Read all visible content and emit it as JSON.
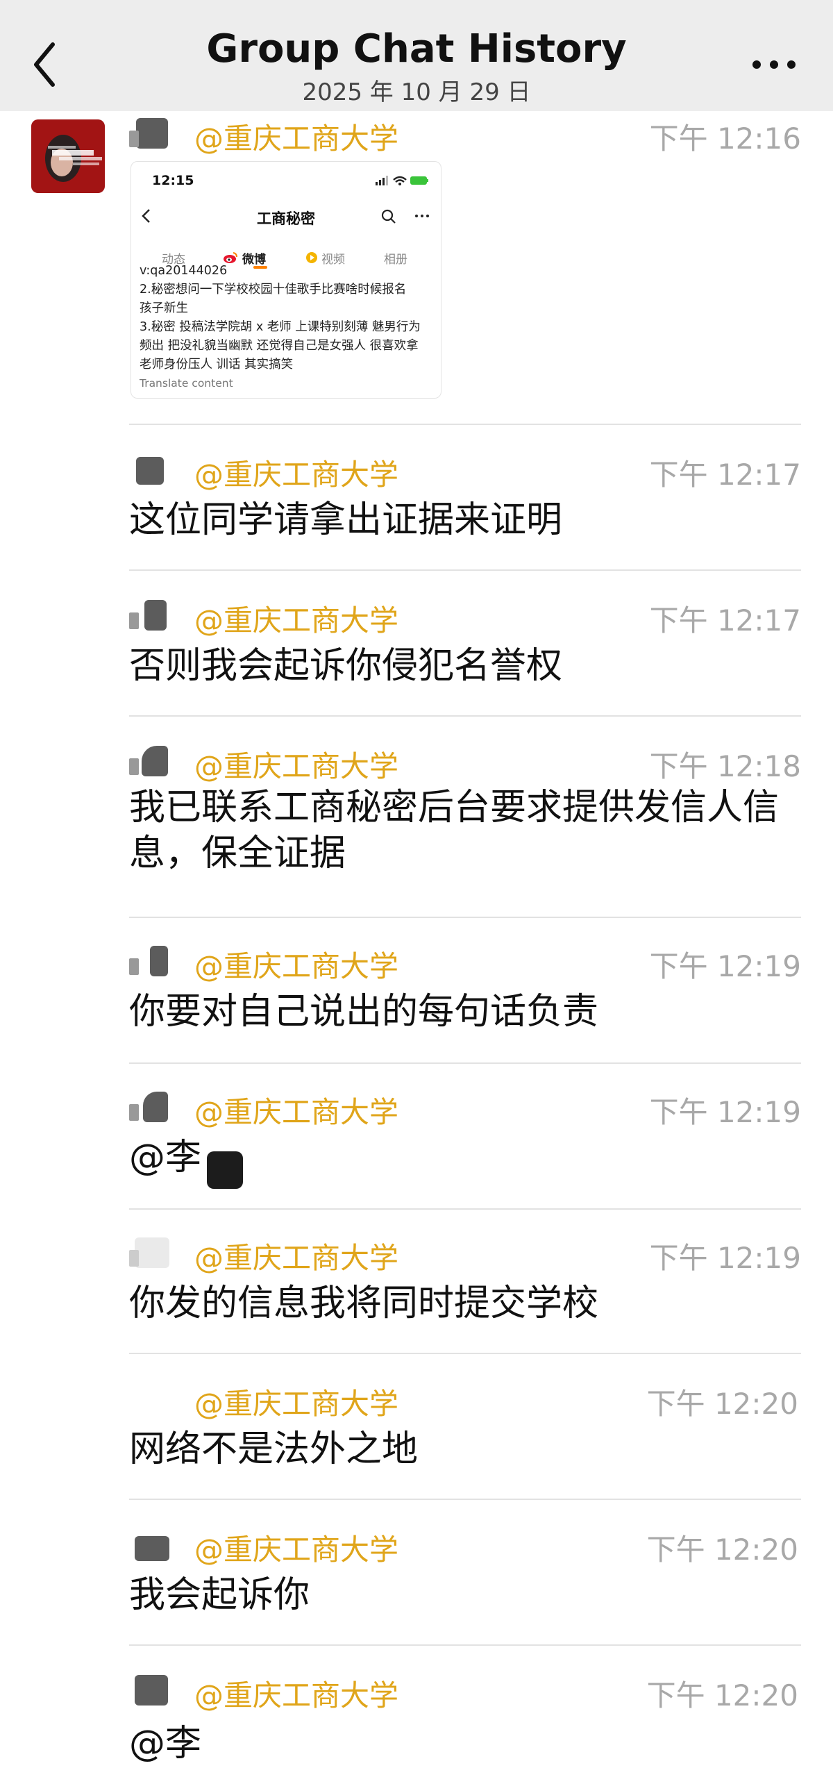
{
  "header": {
    "title": "Group Chat History",
    "date": "2025 年 10 月 29 日"
  },
  "accent_color": "#e0a51a",
  "embedded_screenshot": {
    "status_time": "12:15",
    "page_title": "工商秘密",
    "tabs": [
      "动态",
      "微博",
      "视频",
      "相册"
    ],
    "active_tab": "微博",
    "lines": [
      "v:qa20144026",
      "2.秘密想问一下学校校园十佳歌手比赛啥时候报名",
      "孩子新生",
      "3.秘密 投稿法学院胡 x 老师 上课特别刻薄 魅男行为",
      "频出 把没礼貌当幽默 还觉得自己是女强人 很喜欢拿",
      "老师身份压人 训话 其实搞笑"
    ],
    "translate_label": "Translate content"
  },
  "messages": [
    {
      "org": "@重庆工商大学",
      "time": "下午 12:16",
      "text": ""
    },
    {
      "org": "@重庆工商大学",
      "time": "下午 12:17",
      "text": "这位同学请拿出证据来证明"
    },
    {
      "org": "@重庆工商大学",
      "time": "下午 12:17",
      "text": "否则我会起诉你侵犯名誉权"
    },
    {
      "org": "@重庆工商大学",
      "time": "下午 12:18",
      "text": "我已联系工商秘密后台要求提供发信人信息，保全证据"
    },
    {
      "org": "@重庆工商大学",
      "time": "下午 12:19",
      "text": "你要对自己说出的每句话负责"
    },
    {
      "org": "@重庆工商大学",
      "time": "下午 12:19",
      "text": "@李"
    },
    {
      "org": "@重庆工商大学",
      "time": "下午 12:19",
      "text": "你发的信息我将同时提交学校"
    },
    {
      "org": "@重庆工商大学",
      "time": "下午 12:20",
      "text": "网络不是法外之地"
    },
    {
      "org": "@重庆工商大学",
      "time": "下午 12:20",
      "text": "我会起诉你"
    },
    {
      "org": "@重庆工商大学",
      "time": "下午 12:20",
      "text": "@李"
    }
  ]
}
